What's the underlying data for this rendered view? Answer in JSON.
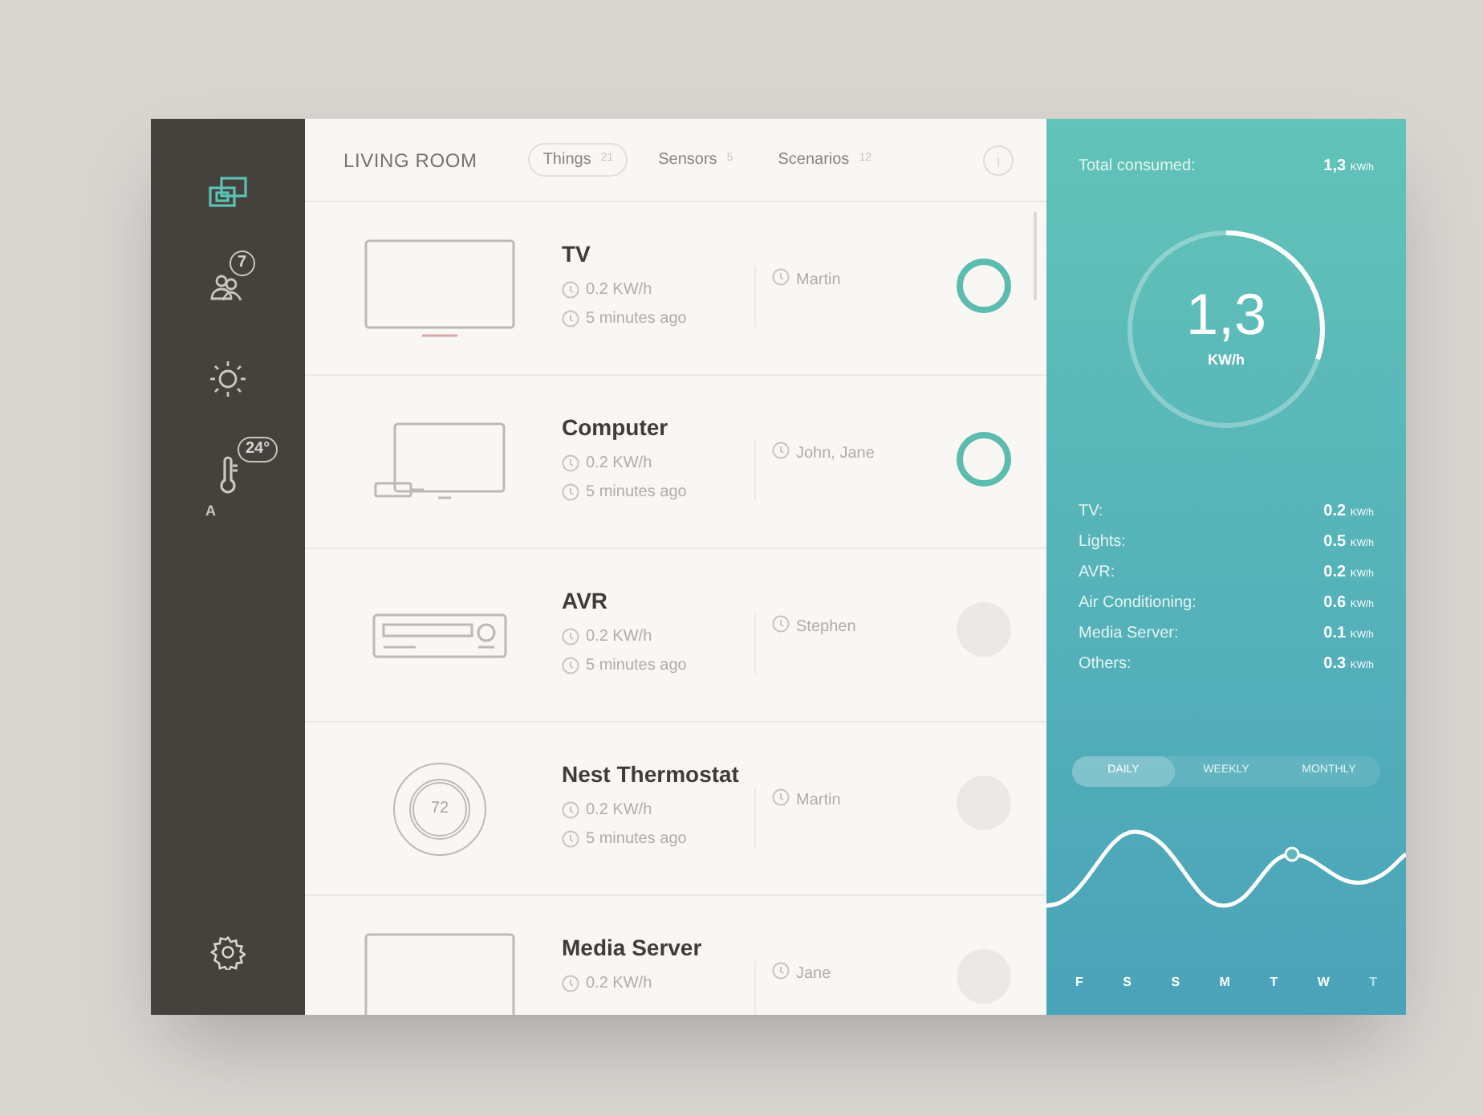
{
  "sidebar": {
    "items": [
      {
        "kind": "devices",
        "selected": true
      },
      {
        "kind": "people",
        "selected": false,
        "badge": "7"
      },
      {
        "kind": "light",
        "selected": false
      },
      {
        "kind": "climate",
        "selected": false,
        "badge": "24°",
        "caption": "A"
      }
    ]
  },
  "header": {
    "room": "LIVING ROOM",
    "tabs": [
      {
        "label": "Things",
        "count": "21",
        "selected": true
      },
      {
        "label": "Sensors",
        "count": "5",
        "selected": false
      },
      {
        "label": "Scenarios",
        "count": "12",
        "selected": false
      }
    ]
  },
  "devices": [
    {
      "kind": "tv",
      "name": "TV",
      "power": "0.2 KW/h",
      "time": "5 minutes ago",
      "user": "Martin",
      "on": true
    },
    {
      "kind": "computer",
      "name": "Computer",
      "power": "0.2 KW/h",
      "time": "5 minutes ago",
      "user": "John, Jane",
      "on": true
    },
    {
      "kind": "avr",
      "name": "AVR",
      "power": "0.2 KW/h",
      "time": "5 minutes ago",
      "user": "Stephen",
      "on": false
    },
    {
      "kind": "thermostat",
      "name": "Nest Thermostat",
      "power": "0.2 KW/h",
      "time": "5 minutes ago",
      "user": "Martin",
      "on": false,
      "display": "72"
    },
    {
      "kind": "tv",
      "name": "Media Server",
      "power": "0.2 KW/h",
      "user": "Jane",
      "on": false
    }
  ],
  "consumption": {
    "label": "Total consumed:",
    "total": "1,3",
    "unit": "KW/h",
    "gauge_value": "1,3",
    "gauge_unit": "KW/h",
    "level": 0.3,
    "breakdown": [
      {
        "name": "TV:",
        "value": "0.2",
        "unit": "KW/h"
      },
      {
        "name": "Lights:",
        "value": "0.5",
        "unit": "KW/h"
      },
      {
        "name": "AVR:",
        "value": "0.2",
        "unit": "KW/h"
      },
      {
        "name": "Air Conditioning:",
        "value": "0.6",
        "unit": "KW/h"
      },
      {
        "name": "Media Server:",
        "value": "0.1",
        "unit": "KW/h"
      },
      {
        "name": "Others:",
        "value": "0.3",
        "unit": "KW/h"
      }
    ],
    "periods": [
      {
        "label": "DAILY",
        "selected": true
      },
      {
        "label": "WEEKLY",
        "selected": false
      },
      {
        "label": "MONTHLY",
        "selected": false
      }
    ],
    "days": [
      {
        "label": "F",
        "past": true
      },
      {
        "label": "S",
        "past": true
      },
      {
        "label": "S",
        "past": true
      },
      {
        "label": "M",
        "past": true
      },
      {
        "label": "T",
        "past": true
      },
      {
        "label": "W",
        "past": true
      },
      {
        "label": "T",
        "past": false
      }
    ]
  }
}
